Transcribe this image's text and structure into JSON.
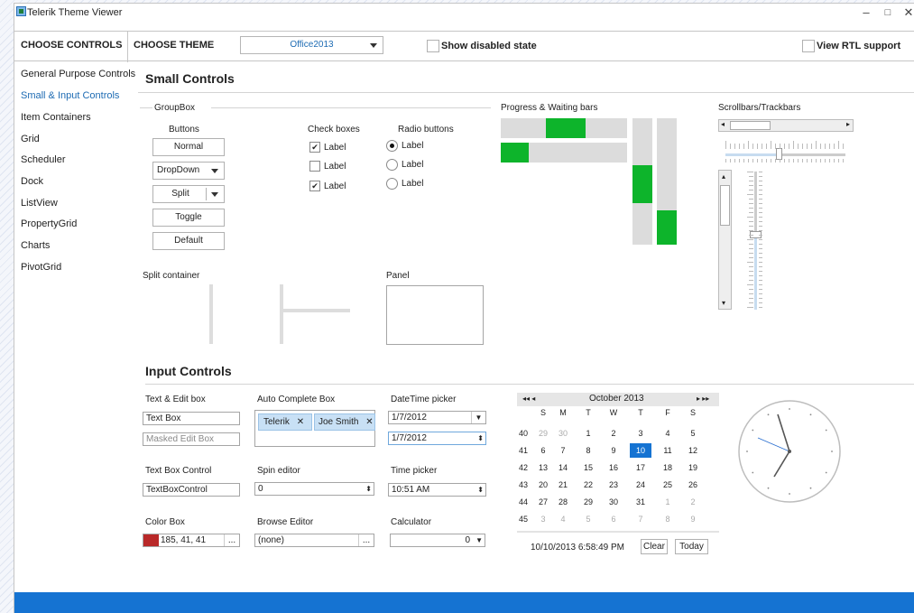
{
  "window": {
    "title": "Telerik Theme Viewer",
    "min": "–",
    "max": "□",
    "close": "✕"
  },
  "toolbar": {
    "choose_controls": "CHOOSE CONTROLS",
    "choose_theme": "CHOOSE THEME",
    "theme_value": "Office2013",
    "show_disabled": "Show disabled state",
    "view_rtl": "View RTL support"
  },
  "nav": [
    "General Purpose Controls",
    "Small & Input Controls",
    "Item Containers",
    "Grid",
    "Scheduler",
    "Dock",
    "ListView",
    "PropertyGrid",
    "Charts",
    "PivotGrid"
  ],
  "small": {
    "title": "Small Controls",
    "groupbox": "GroupBox",
    "buttons_label": "Buttons",
    "normal": "Normal",
    "dropdown": "DropDown",
    "split": "Split",
    "toggle": "Toggle",
    "default": "Default",
    "checkboxes_label": "Check boxes",
    "radios_label": "Radio buttons",
    "item": "Label",
    "check_mark": "✔",
    "progress_label": "Progress & Waiting bars",
    "scroll_label": "Scrollbars/Trackbars",
    "split_container": "Split container",
    "panel": "Panel"
  },
  "progress": {
    "h1_start": 0.36,
    "h1_end": 0.67,
    "h2_end": 0.22,
    "v1_start": 0.37,
    "v1_end": 0.67,
    "v2_start": 0.73,
    "v2_end": 1.0
  },
  "input": {
    "title": "Input Controls",
    "text_edit_label": "Text & Edit box",
    "text_box": "Text Box",
    "masked_placeholder": "Masked Edit Box",
    "autocomplete_label": "Auto Complete Box",
    "tokens": [
      "Telerik",
      "Joe Smith"
    ],
    "token_x": "✕",
    "datetime_label": "DateTime picker",
    "date1": "1/7/2012",
    "date2": "1/7/2012",
    "tbc_label": "Text Box Control",
    "tbc_value": "TextBoxControl",
    "spin_label": "Spin editor",
    "spin_value": "0",
    "time_label": "Time picker",
    "time_value": "10:51 AM",
    "color_label": "Color Box",
    "color_value": "185, 41, 41",
    "color_hex": "#b92929",
    "ellipsis": "...",
    "browse_label": "Browse Editor",
    "browse_value": "(none)",
    "calc_label": "Calculator",
    "calc_value": "0"
  },
  "calendar": {
    "title": "October 2013",
    "nav_left": "◂◂  ◂",
    "nav_right": "▸  ▸▸",
    "weekdays": [
      "S",
      "M",
      "T",
      "W",
      "T",
      "F",
      "S"
    ],
    "weeks": [
      {
        "wk": "40",
        "days": [
          "29",
          "30",
          "1",
          "2",
          "3",
          "4",
          "5"
        ]
      },
      {
        "wk": "41",
        "days": [
          "6",
          "7",
          "8",
          "9",
          "10",
          "11",
          "12"
        ]
      },
      {
        "wk": "42",
        "days": [
          "13",
          "14",
          "15",
          "16",
          "17",
          "18",
          "19"
        ]
      },
      {
        "wk": "43",
        "days": [
          "20",
          "21",
          "22",
          "23",
          "24",
          "25",
          "26"
        ]
      },
      {
        "wk": "44",
        "days": [
          "27",
          "28",
          "29",
          "30",
          "31",
          "1",
          "2"
        ]
      },
      {
        "wk": "45",
        "days": [
          "3",
          "4",
          "5",
          "6",
          "7",
          "8",
          "9"
        ]
      }
    ],
    "selected": "10",
    "datetime": "10/10/2013 6:58:49 PM",
    "clear": "Clear",
    "today": "Today"
  },
  "colors": {
    "accent": "#1d6bb3",
    "footer": "#1573d2",
    "progress": "#0db42b",
    "selected_day": "#1573d2"
  }
}
